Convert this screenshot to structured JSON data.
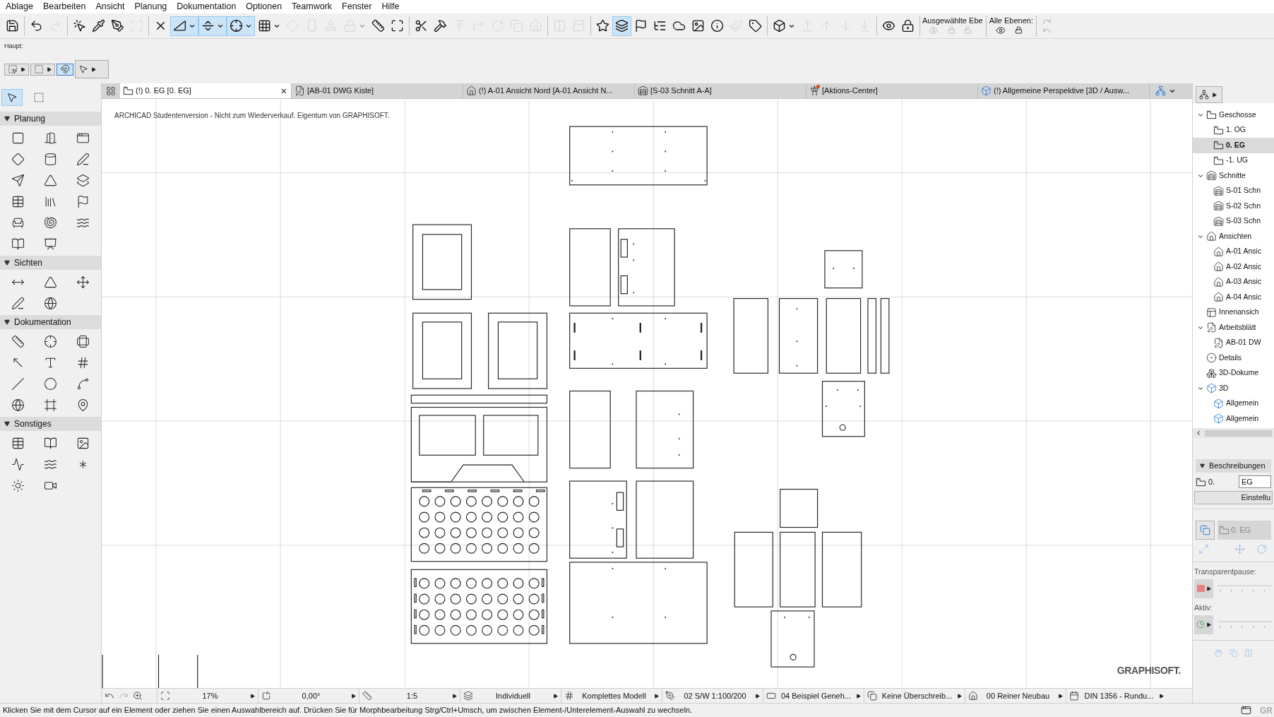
{
  "menu": [
    "Ablage",
    "Bearbeiten",
    "Ansicht",
    "Planung",
    "Dokumentation",
    "Optionen",
    "Teamwork",
    "Fenster",
    "Hilfe"
  ],
  "toolbar": {
    "groups": [
      [
        {
          "selected": false,
          "disabled": false,
          "dropdown": false
        }
      ],
      [
        {
          "selected": false,
          "disabled": false,
          "dropdown": false
        },
        {
          "selected": false,
          "disabled": true,
          "dropdown": false
        }
      ],
      [
        {
          "selected": false,
          "disabled": false,
          "dropdown": false
        },
        {
          "selected": false,
          "disabled": false,
          "dropdown": false
        },
        {
          "selected": false,
          "disabled": false,
          "dropdown": false
        },
        {
          "selected": false,
          "disabled": true,
          "dropdown": false
        }
      ],
      [
        {
          "selected": false,
          "disabled": false,
          "dropdown": false
        },
        {
          "selected": true,
          "disabled": false,
          "dropdown": true
        },
        {
          "selected": true,
          "disabled": false,
          "dropdown": true
        },
        {
          "selected": true,
          "disabled": false,
          "dropdown": true
        },
        {
          "selected": false,
          "disabled": false,
          "dropdown": true
        },
        {
          "selected": false,
          "disabled": true,
          "dropdown": false
        },
        {
          "selected": false,
          "disabled": true,
          "dropdown": false
        },
        {
          "selected": false,
          "disabled": true,
          "dropdown": false
        },
        {
          "selected": false,
          "disabled": true,
          "dropdown": true
        },
        {
          "selected": false,
          "disabled": false,
          "dropdown": false
        },
        {
          "selected": false,
          "disabled": false,
          "dropdown": false
        }
      ],
      [
        {
          "selected": false,
          "disabled": false,
          "dropdown": false
        },
        {
          "selected": false,
          "disabled": false,
          "dropdown": false
        },
        {
          "selected": false,
          "disabled": true,
          "dropdown": false
        },
        {
          "selected": false,
          "disabled": true,
          "dropdown": false
        },
        {
          "selected": false,
          "disabled": true,
          "dropdown": false
        },
        {
          "selected": false,
          "disabled": true,
          "dropdown": false
        },
        {
          "selected": false,
          "disabled": true,
          "dropdown": false
        }
      ],
      [
        {
          "selected": false,
          "disabled": true,
          "dropdown": false
        },
        {
          "selected": false,
          "disabled": true,
          "dropdown": false
        }
      ],
      [
        {
          "selected": false,
          "disabled": false,
          "dropdown": false
        },
        {
          "selected": true,
          "disabled": false,
          "dropdown": false
        },
        {
          "selected": false,
          "disabled": false,
          "dropdown": false
        },
        {
          "selected": false,
          "disabled": false,
          "dropdown": false
        },
        {
          "selected": false,
          "disabled": false,
          "dropdown": false
        },
        {
          "selected": false,
          "disabled": false,
          "dropdown": false
        },
        {
          "selected": false,
          "disabled": false,
          "dropdown": false
        },
        {
          "selected": false,
          "disabled": true,
          "dropdown": false
        },
        {
          "selected": false,
          "disabled": false,
          "dropdown": false
        }
      ],
      [
        {
          "selected": false,
          "disabled": false,
          "dropdown": true
        },
        {
          "selected": false,
          "disabled": true,
          "dropdown": false
        },
        {
          "selected": false,
          "disabled": true,
          "dropdown": false
        },
        {
          "selected": false,
          "disabled": true,
          "dropdown": false
        },
        {
          "selected": false,
          "disabled": true,
          "dropdown": false
        }
      ],
      [
        {
          "selected": false,
          "disabled": false,
          "dropdown": false
        },
        {
          "selected": false,
          "disabled": false,
          "dropdown": false
        }
      ]
    ],
    "layers": [
      {
        "label": "Ausgewählte Ebe",
        "disabled": true
      },
      {
        "label": "Alle Ebenen:",
        "disabled": false
      }
    ]
  },
  "haupt": {
    "label": "Haupt:",
    "buttons": [
      {
        "selected": false,
        "dropdown": true
      },
      {
        "selected": false,
        "dropdown": true
      },
      {
        "selected": true,
        "dropdown": false
      },
      {
        "selected": false,
        "dropdown": true
      }
    ]
  },
  "toolbox": {
    "top_tools": [
      {
        "selected": true
      },
      {
        "selected": false
      }
    ],
    "sections": [
      {
        "label": "Planung",
        "expanded": true
      },
      {
        "label": "Sichten",
        "expanded": true
      },
      {
        "label": "Dokumentation",
        "expanded": true
      },
      {
        "label": "Sonstiges",
        "expanded": true
      }
    ]
  },
  "tabs": [
    {
      "label": "(!) 0. EG [0. EG]",
      "selected": true,
      "kind": "floor",
      "close": "×"
    },
    {
      "label": "[AB-01 DWG Kiste]",
      "selected": false,
      "kind": "worksheet"
    },
    {
      "label": "(!) A-01 Ansicht Nord [A-01 Ansicht N...",
      "selected": false,
      "kind": "elevation"
    },
    {
      "label": "[S-03 Schnitt A-A]",
      "selected": false,
      "kind": "section"
    },
    {
      "label": "[Aktions-Center]",
      "selected": false,
      "kind": "action"
    },
    {
      "label": "(!) Allgemeine Perspektive [3D / Ausw...",
      "selected": false,
      "kind": "view3d"
    }
  ],
  "canvas": {
    "notice": "ARCHICAD Studentenversion - Nicht zum Wiederverkauf. Eigentum von GRAPHISOFT.",
    "logo": "GRAPHISOFT."
  },
  "view_bar": [
    {
      "kind": "zoom",
      "value": "17%"
    },
    {
      "kind": "angle",
      "value": "0,00°"
    },
    {
      "kind": "scale",
      "value": "1:5"
    },
    {
      "kind": "layers",
      "value": "Individuell"
    },
    {
      "kind": "model",
      "value": "Komplettes Modell"
    },
    {
      "kind": "pen",
      "value": "02 S/W 1:100/200"
    },
    {
      "kind": "graphic",
      "value": "04 Beispiel Geneh..."
    },
    {
      "kind": "override",
      "value": "Keine Überschreib..."
    },
    {
      "kind": "renovation",
      "value": "00 Reiner Neubau"
    },
    {
      "kind": "dimension",
      "value": "DIN 1356 - Rundu..."
    }
  ],
  "navigator": {
    "tree": [
      {
        "label": "Geschosse",
        "kind": "floor",
        "selected": false,
        "expanded": true,
        "children": [
          {
            "label": "1. OG",
            "kind": "floor",
            "selected": false
          },
          {
            "label": "0. EG",
            "kind": "floor",
            "selected": true
          },
          {
            "label": "-1. UG",
            "kind": "floor",
            "selected": false
          }
        ]
      },
      {
        "label": "Schnitte",
        "kind": "section",
        "selected": false,
        "expanded": true,
        "children": [
          {
            "label": "S-01 Schn",
            "kind": "section",
            "selected": false
          },
          {
            "label": "S-02 Schn",
            "kind": "section",
            "selected": false
          },
          {
            "label": "S-03 Schn",
            "kind": "section",
            "selected": false
          }
        ]
      },
      {
        "label": "Ansichten",
        "kind": "elevation",
        "selected": false,
        "expanded": true,
        "children": [
          {
            "label": "A-01 Ansic",
            "kind": "elevation",
            "selected": false
          },
          {
            "label": "A-02 Ansic",
            "kind": "elevation",
            "selected": false
          },
          {
            "label": "A-03 Ansic",
            "kind": "elevation",
            "selected": false
          },
          {
            "label": "A-04 Ansic",
            "kind": "elevation",
            "selected": false
          }
        ]
      },
      {
        "label": "Innenansich",
        "kind": "interior",
        "selected": false
      },
      {
        "label": "Arbeitsblätt",
        "kind": "worksheet",
        "selected": false,
        "expanded": true,
        "children": [
          {
            "label": "AB-01 DW",
            "kind": "worksheet",
            "selected": false
          }
        ]
      },
      {
        "label": "Details",
        "kind": "detail",
        "selected": false
      },
      {
        "label": "3D-Dokume",
        "kind": "doc3d",
        "selected": false
      },
      {
        "label": "3D",
        "kind": "view3d",
        "selected": false,
        "expanded": true,
        "children": [
          {
            "label": "Allgemein",
            "kind": "view3d",
            "selected": false
          },
          {
            "label": "Allgemein",
            "kind": "view3d",
            "selected": false
          }
        ]
      }
    ]
  },
  "properties": {
    "header": "Beschreibungen",
    "expanded": true,
    "id_label": "0.",
    "name_value": "EG",
    "settings_button": "Einstellu",
    "context_field": "0. EG",
    "transparency_label": "Transparentpause:",
    "active_label": "Aktiv:"
  },
  "status_bar": {
    "message": "Klicken Sie mit dem Cursor auf ein Element oder ziehen Sie einen Auswahlbereich auf. Drücken Sie für Morphbearbeitung Strg/Ctrl+Umsch, um zwischen Element-/Unterelement-Auswahl zu wechseln.",
    "brand": "GR"
  }
}
